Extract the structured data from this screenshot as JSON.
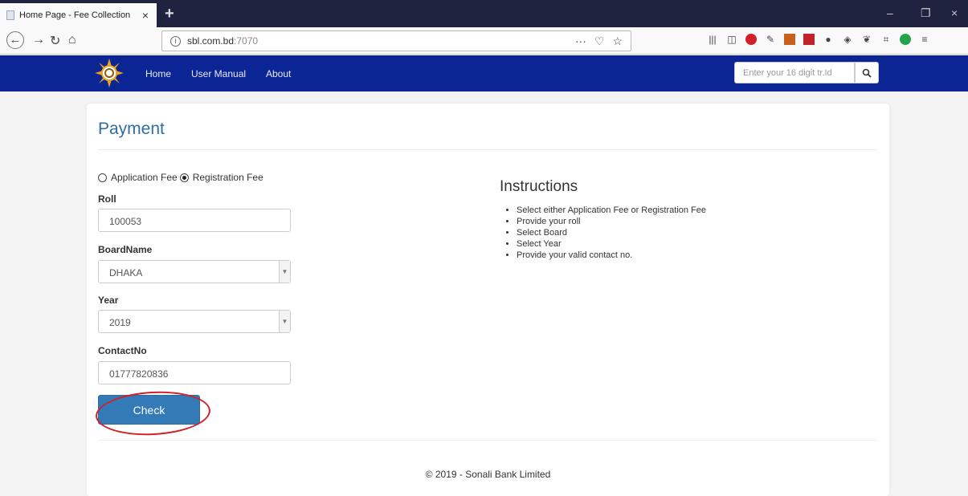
{
  "browser": {
    "tab_title": "Home Page - Fee Collection",
    "tab_close": "×",
    "new_tab": "+",
    "url_host": "sbl.com.bd",
    "url_port": ":7070",
    "url_actions": "···",
    "window_controls": [
      "–",
      "❐",
      "×"
    ]
  },
  "site_nav": {
    "links": [
      "Home",
      "User Manual",
      "About"
    ],
    "search_placeholder": "Enter your 16 digit tr.Id"
  },
  "panel": {
    "title": "Payment",
    "fee_options": [
      "Application Fee",
      "Registration Fee"
    ],
    "selected_fee": "Registration Fee",
    "fields": {
      "roll_label": "Roll",
      "roll_value": "100053",
      "board_label": "BoardName",
      "board_value": "DHAKA",
      "year_label": "Year",
      "year_value": "2019",
      "contact_label": "ContactNo",
      "contact_value": "01777820836"
    },
    "check_label": "Check",
    "instructions_title": "Instructions",
    "instructions": [
      "Select either Application Fee or Registration Fee",
      "Provide your roll",
      "Select Board",
      "Select Year",
      "Provide your valid contact no."
    ],
    "footer": "© 2019 - Sonali Bank Limited"
  },
  "colors": {
    "header_bg": "#0b2595",
    "primary": "#337ab7",
    "highlight": "#d0202a"
  }
}
